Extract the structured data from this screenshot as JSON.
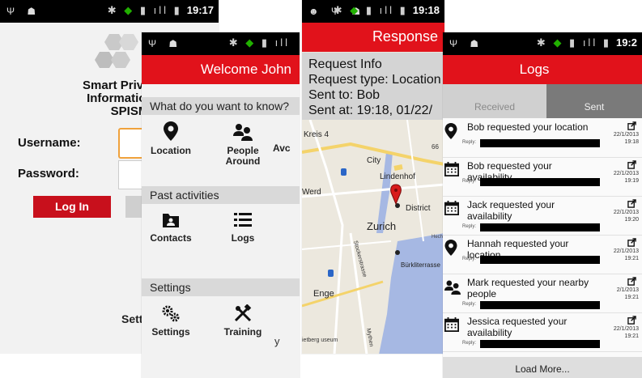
{
  "screen1": {
    "time": "19:17",
    "title_lines": [
      "Smart Privacy-A",
      "Information Sh",
      "SPISM"
    ],
    "username_label": "Username:",
    "password_label": "Password:",
    "login_label": "Log In",
    "settings_partial": "Sett"
  },
  "screen2": {
    "header": "Welcome John",
    "section_know": "What do you want to know?",
    "tile_location": "Location",
    "tile_people": "People Around",
    "tile_activity": "Avc",
    "section_past": "Past activities",
    "tile_contacts": "Contacts",
    "tile_logs": "Logs",
    "section_settings": "Settings",
    "tile_settings": "Settings",
    "tile_training": "Training",
    "partial_y": "y"
  },
  "screen3": {
    "time": "19:18",
    "header": "Response",
    "info_lines": [
      "Request Info",
      "Request type: Location",
      "Sent to: Bob",
      "Sent at: 19:18, 01/22/"
    ],
    "map_labels": {
      "kreis4": "Kreis 4",
      "city": "City",
      "num66": "66",
      "lindenhof": "Lindenhof",
      "werd": "Werd",
      "district": "District",
      "zurich": "Zurich",
      "stock": "Stockerstrasse",
      "burkli": "Bürkliterrasse",
      "enge": "Enge",
      "mythen": "Mythen",
      "rietberg": "ietberg useum",
      "hech": "Hech"
    }
  },
  "screen4": {
    "time": "19:2",
    "header": "Logs",
    "tab_received": "Received",
    "tab_sent": "Sent",
    "reply_label": "Reply:",
    "entries": [
      {
        "text": "Bob requested your location",
        "date": "22/1/2013",
        "time": "19:18",
        "icon": "location-icon"
      },
      {
        "text": "Bob requested your availability",
        "date": "22/1/2013",
        "time": "19:19",
        "icon": "calendar-icon"
      },
      {
        "text": "Jack requested your availability",
        "date": "22/1/2013",
        "time": "19:20",
        "icon": "calendar-icon"
      },
      {
        "text": "Hannah requested your location",
        "date": "22/1/2013",
        "time": "19:21",
        "icon": "location-icon"
      },
      {
        "text": "Mark requested your nearby people",
        "date": "2/1/2013",
        "time": "19:21",
        "icon": "people-icon"
      },
      {
        "text": "Jessica requested your availability",
        "date": "22/1/2013",
        "time": "19:21",
        "icon": "calendar-icon"
      }
    ],
    "load_more": "Load More..."
  },
  "colors": {
    "accent": "#e1121b",
    "section": "#d9d9d9",
    "tab_active": "#7a7a7a"
  }
}
